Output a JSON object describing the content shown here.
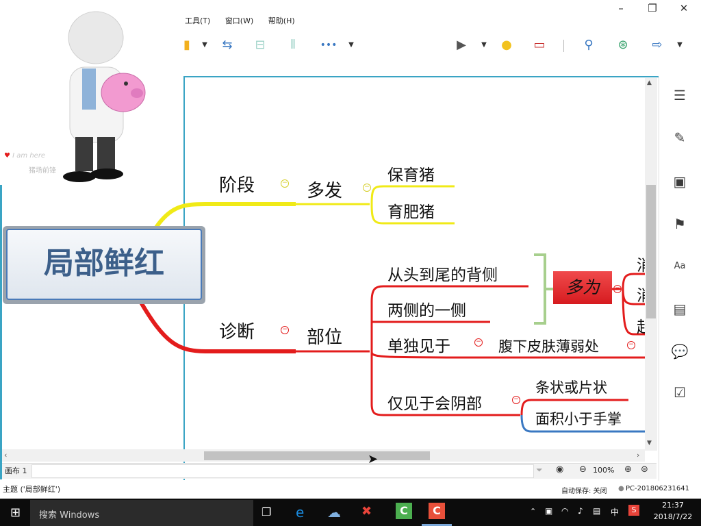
{
  "window": {
    "minimize_label": "–",
    "restore_label": "❐",
    "close_label": "✕"
  },
  "menu": {
    "tools": "工具(T)",
    "window": "窗口(W)",
    "help": "帮助(H)"
  },
  "toolbar": {
    "more_label": "•••"
  },
  "mascot": {
    "tagline": "I am here",
    "subtitle": "猪场前锋"
  },
  "mindmap": {
    "central_topic": "局部鲜红",
    "branches": {
      "stage": {
        "label": "阶段",
        "child": "多发",
        "leaves": [
          "保育猪",
          "育肥猪"
        ]
      },
      "diagnosis": {
        "label": "诊断",
        "child": "部位",
        "leaves": [
          "从头到尾的背侧",
          "两侧的一侧",
          "单独见于",
          "仅见于会阴部"
        ],
        "summary_label": "多为",
        "summary_partials": [
          "消",
          "消",
          "起"
        ],
        "single_detail": "腹下皮肤薄弱处",
        "perineum_details": [
          "条状或片状",
          "面积小于手掌"
        ]
      }
    }
  },
  "canvas_bar": {
    "tab_label": "画布 1",
    "zoom": "100%"
  },
  "status": {
    "topic": "主题 ('局部鲜红')",
    "autosave": "自动保存: 关闭",
    "pc_name": "PC-201806231641"
  },
  "taskbar": {
    "search_placeholder": "搜索 Windows",
    "time": "21:37",
    "date": "2018/7/22",
    "ime": "中"
  },
  "colors": {
    "stage_branch": "#f0ea17",
    "diagnosis_branch": "#e31c1c",
    "frame": "#3aa4c4",
    "summary_fill": "#e2262a"
  }
}
